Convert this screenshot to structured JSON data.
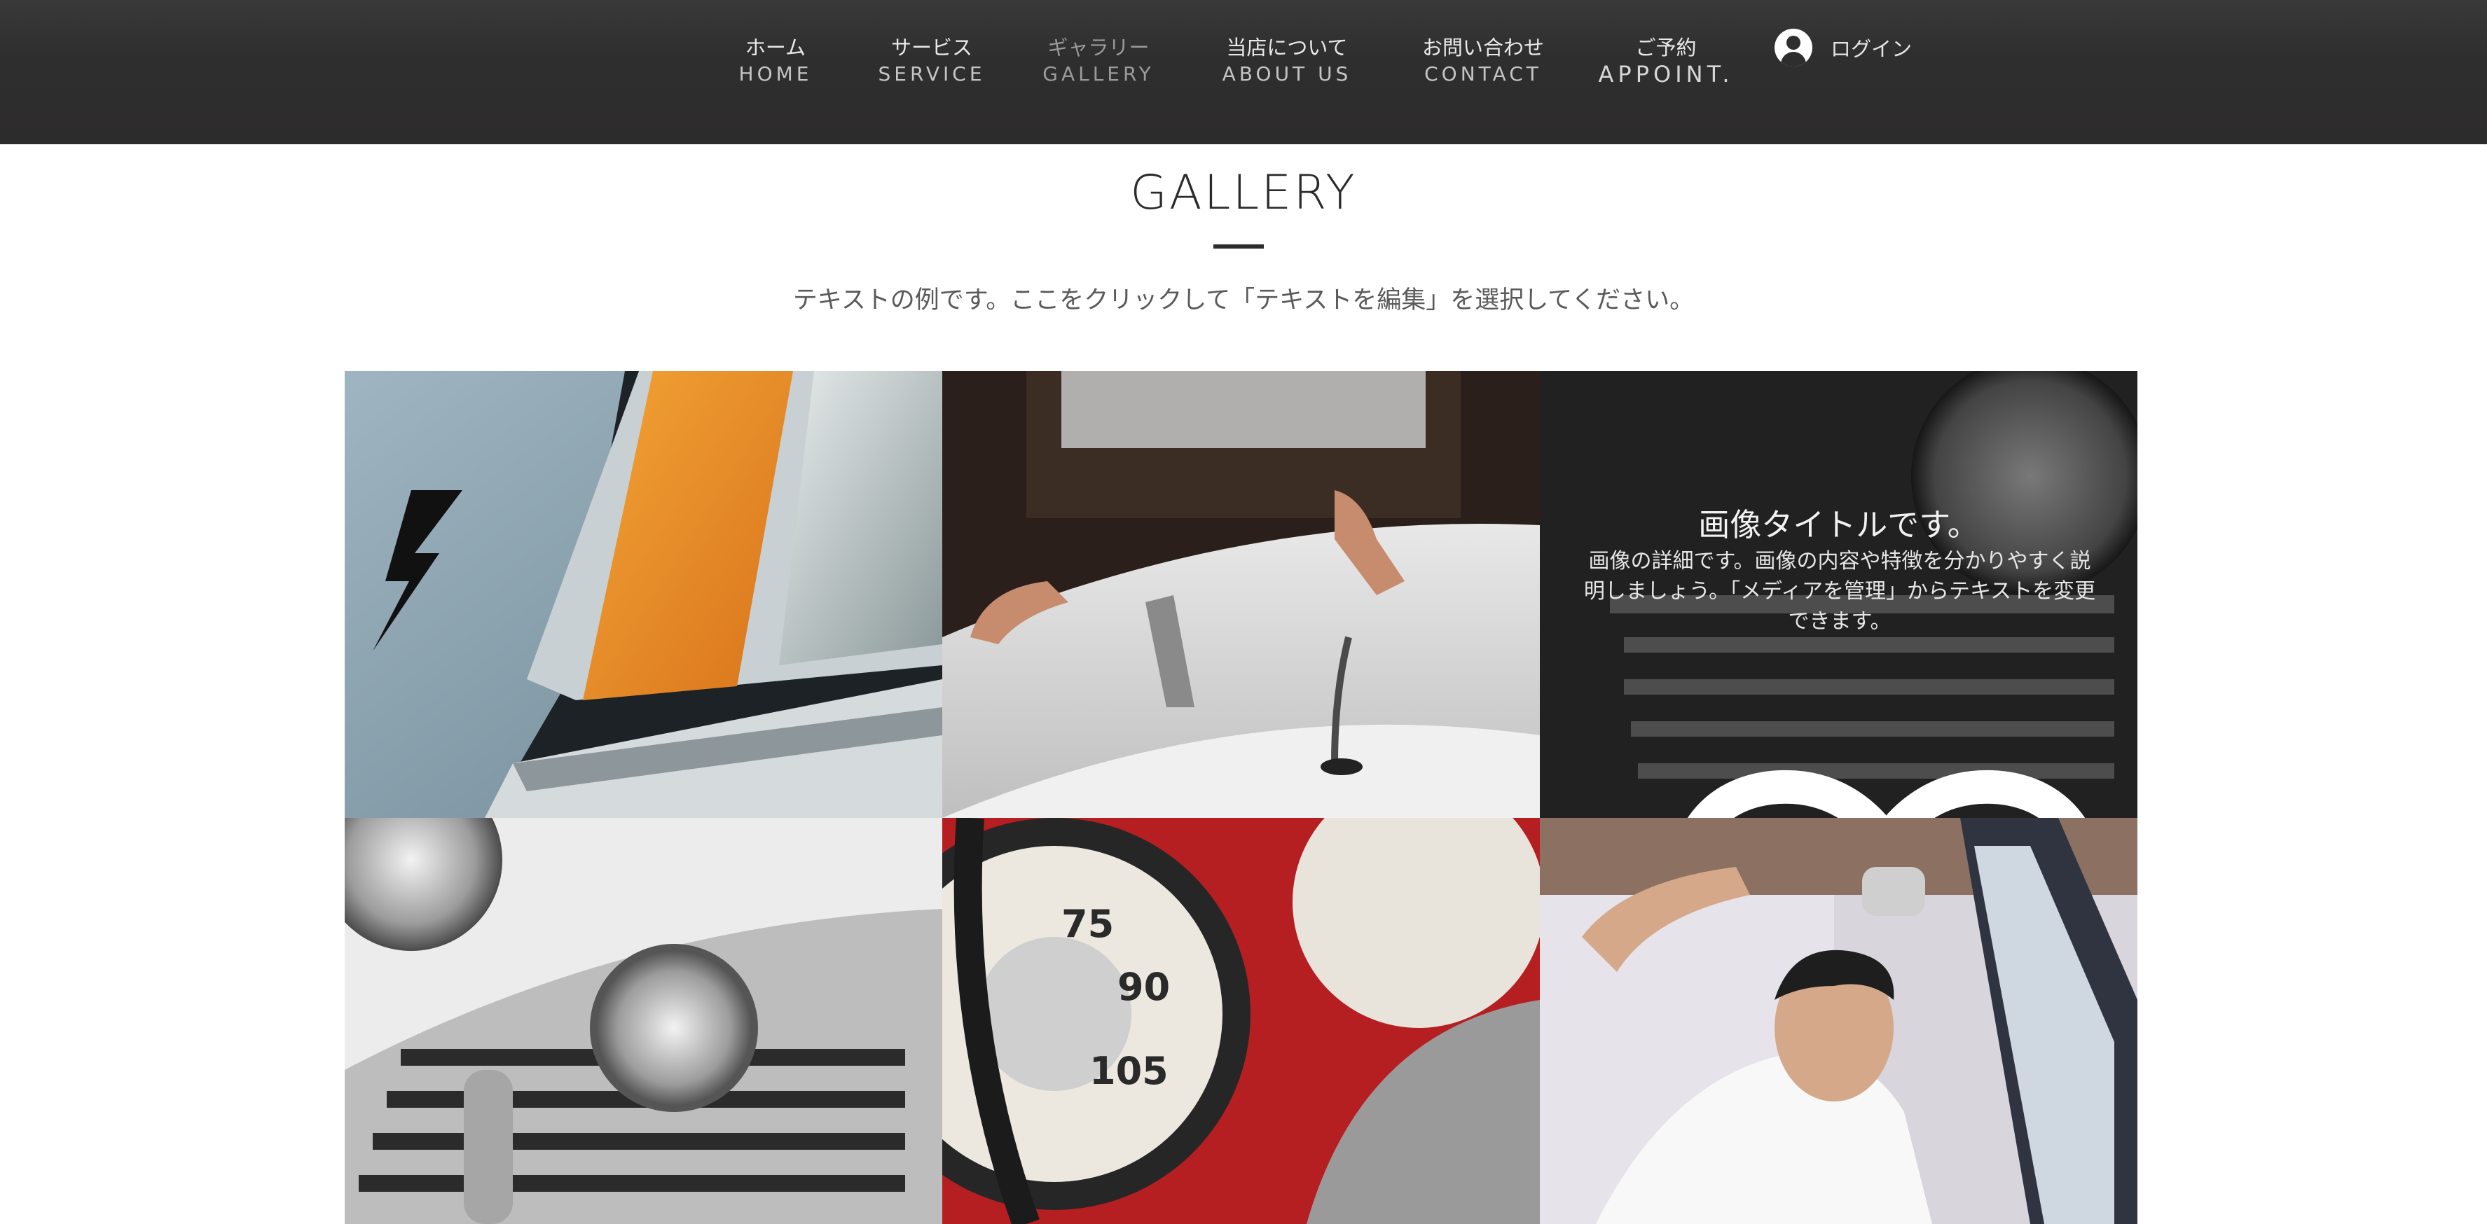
{
  "nav": {
    "items": [
      {
        "jp": "ホーム",
        "en": "HOME"
      },
      {
        "jp": "サービス",
        "en": "SERVICE"
      },
      {
        "jp": "ギャラリー",
        "en": "GALLERY"
      },
      {
        "jp": "当店について",
        "en": "ABOUT US"
      },
      {
        "jp": "お問い合わせ",
        "en": "CONTACT"
      },
      {
        "jp": "ご予約",
        "en": "APPOINT."
      }
    ],
    "active_index": 2,
    "login_label": "ログイン"
  },
  "page": {
    "title": "GALLERY",
    "subtitle": "テキストの例です。ここをクリックして「テキストを編集」を選択してください。"
  },
  "gallery": {
    "items": [
      {
        "subject": "car headlight with orange turn signal and lightning bolt decal"
      },
      {
        "subject": "hands polishing white car hood"
      },
      {
        "subject": "classic car chrome grille and headlight",
        "hover": true
      },
      {
        "subject": "white classic car grille with fog light"
      },
      {
        "subject": "red dashboard speedometer and steering wheel"
      },
      {
        "subject": "mechanic inspecting car door"
      }
    ],
    "hover_overlay": {
      "title": "画像タイトルです。",
      "description": "画像の詳細です。画像の内容や特徴を分かりやすく説明しましょう。「メディアを管理」からテキストを変更できます。",
      "like_icon": "heart-icon",
      "share_icon": "share-icon"
    }
  },
  "colors": {
    "header_bg": "#2f2e2e",
    "nav_text": "#e9e9e9",
    "nav_active": "#9b9b9b",
    "title_text": "#2b2b2b"
  }
}
